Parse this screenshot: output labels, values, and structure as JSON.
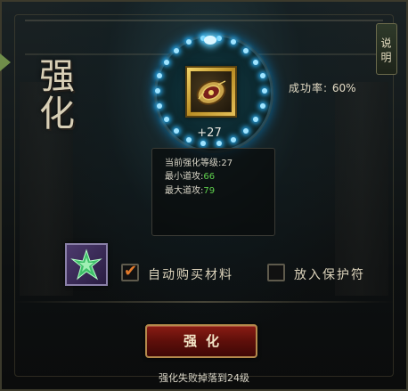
{
  "panel": {
    "title": "强化",
    "help_tab": "说明"
  },
  "item": {
    "level_plus": "+27",
    "icon": "golden-shield-icon"
  },
  "stats": {
    "current_level_label": "当前强化等级:",
    "current_level_value": "27",
    "min_attack_label": "最小道攻:",
    "min_attack_value": "66",
    "max_attack_label": "最大道攻:",
    "max_attack_value": "79"
  },
  "success_rate": {
    "label": "成功率:",
    "value": "60%"
  },
  "options": {
    "auto_buy_label": "自动购买材料",
    "auto_buy_checked": true,
    "protect_label": "放入保护符",
    "protect_checked": false
  },
  "material_slot": {
    "icon": "green-star-crystal-icon"
  },
  "enhance_button": {
    "label": "强化"
  },
  "footer": {
    "note": "强化失败掉落到24级"
  },
  "colors": {
    "accent_green": "#5fd14d",
    "button_red": "#8a1c14",
    "check_orange": "#e37a2b",
    "ring_glow": "#2ab6ff"
  }
}
